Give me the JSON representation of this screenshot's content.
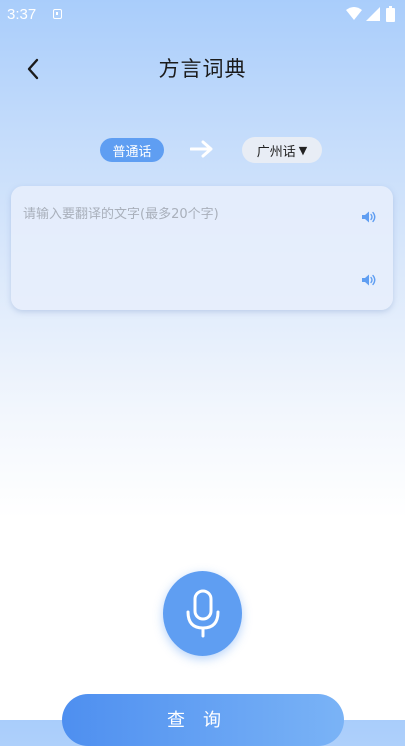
{
  "status_bar": {
    "time": "3:37",
    "icons": [
      "notification-icon",
      "wifi-icon",
      "signal-icon",
      "battery-icon"
    ]
  },
  "header": {
    "title": "方言词典",
    "back_icon": "chevron-left-icon"
  },
  "language_switch": {
    "source": "普通话",
    "arrow_icon": "arrow-right-icon",
    "target": "广州话",
    "target_caret": "▼"
  },
  "translation_card": {
    "input_value": "",
    "input_placeholder": "请输入要翻译的文字(最多20个字)",
    "speaker_icon": "speaker-icon"
  },
  "actions": {
    "mic_icon": "microphone-icon",
    "query_label": "查询"
  },
  "colors": {
    "accent": "#5f9ef2",
    "title": "#1b1b1b",
    "placeholder": "#a9b0bb"
  }
}
